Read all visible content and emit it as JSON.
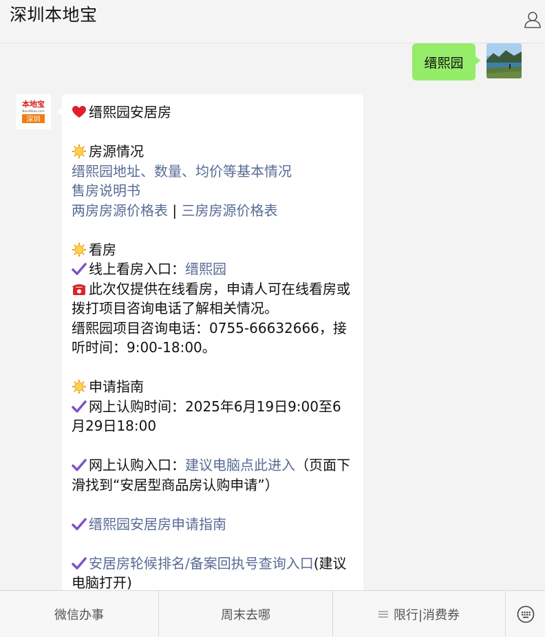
{
  "header": {
    "title": "深圳本地宝",
    "profile_icon": "user-icon"
  },
  "outgoing": {
    "text": "缙熙园",
    "avatar": "landscape-photo"
  },
  "bot": {
    "avatar": {
      "logo_top": "本地宝",
      "logo_mid": "Bendibao.com",
      "logo_bottom": "深圳"
    },
    "message": {
      "heading": "缙熙园安居房",
      "section1_title": "房源情况",
      "link_basic_info": "缙熙园地址、数量、均价等基本情况",
      "link_sales_manual": "售房说明书",
      "link_two_room": "两房房源价格表",
      "separator": " | ",
      "link_three_room": "三房房源价格表",
      "section2_title": "看房",
      "online_view_label": "线上看房入口：",
      "online_view_link": "缙熙园",
      "phone_note": "此次仅提供在线看房，申请人可在线看房或拨打项目咨询电话了解相关情况。",
      "phone_info": "缙熙园项目咨询电话：0755-66632666，接听时间：9:00-18:00。",
      "section3_title": "申请指南",
      "subscribe_time": "网上认购时间：2025年6月19日9:00至6月29日18:00",
      "subscribe_entry_label": "网上认购入口：",
      "subscribe_entry_link": "建议电脑点此进入",
      "subscribe_entry_note": "（页面下滑找到“安居型商品房认购申请”）",
      "guide_link": "缙熙园安居房申请指南",
      "query_link": "安居房轮候排名/备案回执号查询入口",
      "query_note": "(建议电脑打开)"
    }
  },
  "footer": {
    "tab1": "微信办事",
    "tab2": "周末去哪",
    "tab3": "限行|消费券",
    "keyboard_icon": "keyboard-icon"
  },
  "colors": {
    "link": "#576b95",
    "bubble_out": "#95ec69",
    "check": "#7b52c8"
  }
}
